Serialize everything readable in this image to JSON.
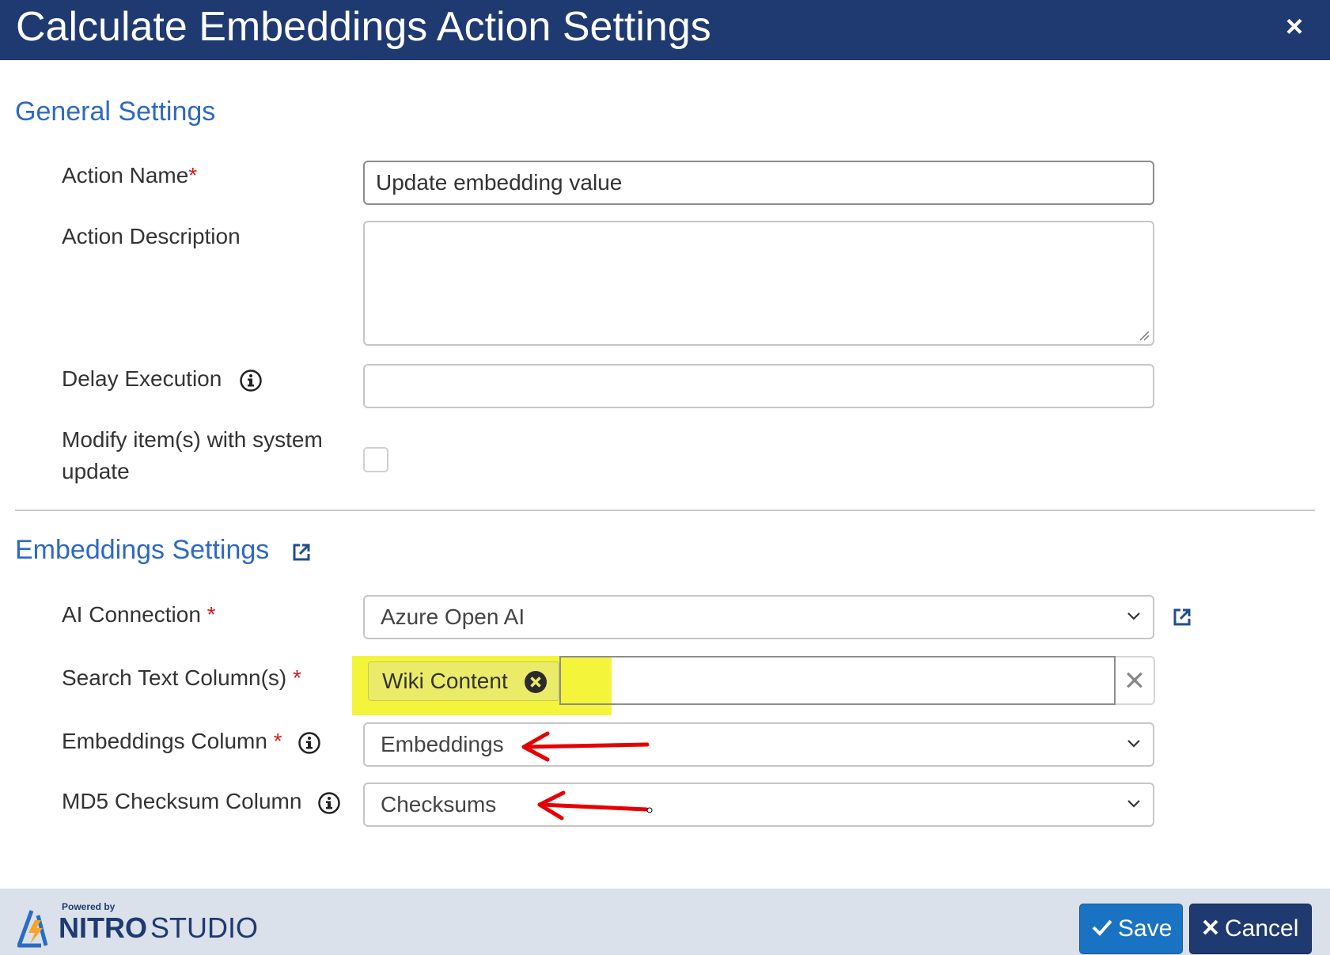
{
  "dialog": {
    "title": "Calculate Embeddings Action Settings",
    "close_label": "×"
  },
  "general": {
    "heading": "General Settings",
    "action_name_label": "Action Name",
    "action_name_value": "Update embedding value",
    "action_description_label": "Action Description",
    "action_description_value": "",
    "delay_execution_label": "Delay Execution",
    "delay_execution_value": "",
    "system_update_label_line1": "Modify item(s) with system",
    "system_update_label_line2": "update",
    "system_update_checked": false
  },
  "embeddings": {
    "heading": "Embeddings Settings",
    "ai_connection_label": "AI Connection",
    "ai_connection_value": "Azure Open AI",
    "search_text_label": "Search Text Column(s)",
    "search_text_tags": [
      "Wiki Content"
    ],
    "embeddings_column_label": "Embeddings Column",
    "embeddings_column_value": "Embeddings",
    "md5_label": "MD5 Checksum Column",
    "md5_value": "Checksums",
    "required_mark": "*"
  },
  "footer": {
    "powered_by": "Powered by",
    "brand_bold": "NITRO",
    "brand_light": "STUDIO",
    "save_label": "Save",
    "cancel_label": "Cancel"
  },
  "colors": {
    "title_bar": "#1f3a70",
    "section_heading": "#2e68c4",
    "required": "#d21c1c",
    "highlight": "#f4f53a",
    "annotation_arrow": "#e60000",
    "save_button": "#1a73c2",
    "cancel_button": "#1f3a70",
    "footer": "#dbe1ea"
  },
  "icons": [
    "close-icon",
    "info-icon",
    "external-link-icon",
    "chevron-down-icon",
    "tag-remove-icon",
    "clear-icon",
    "check-icon",
    "x-icon",
    "nitro-logo-icon",
    "red-arrow-annotation"
  ]
}
